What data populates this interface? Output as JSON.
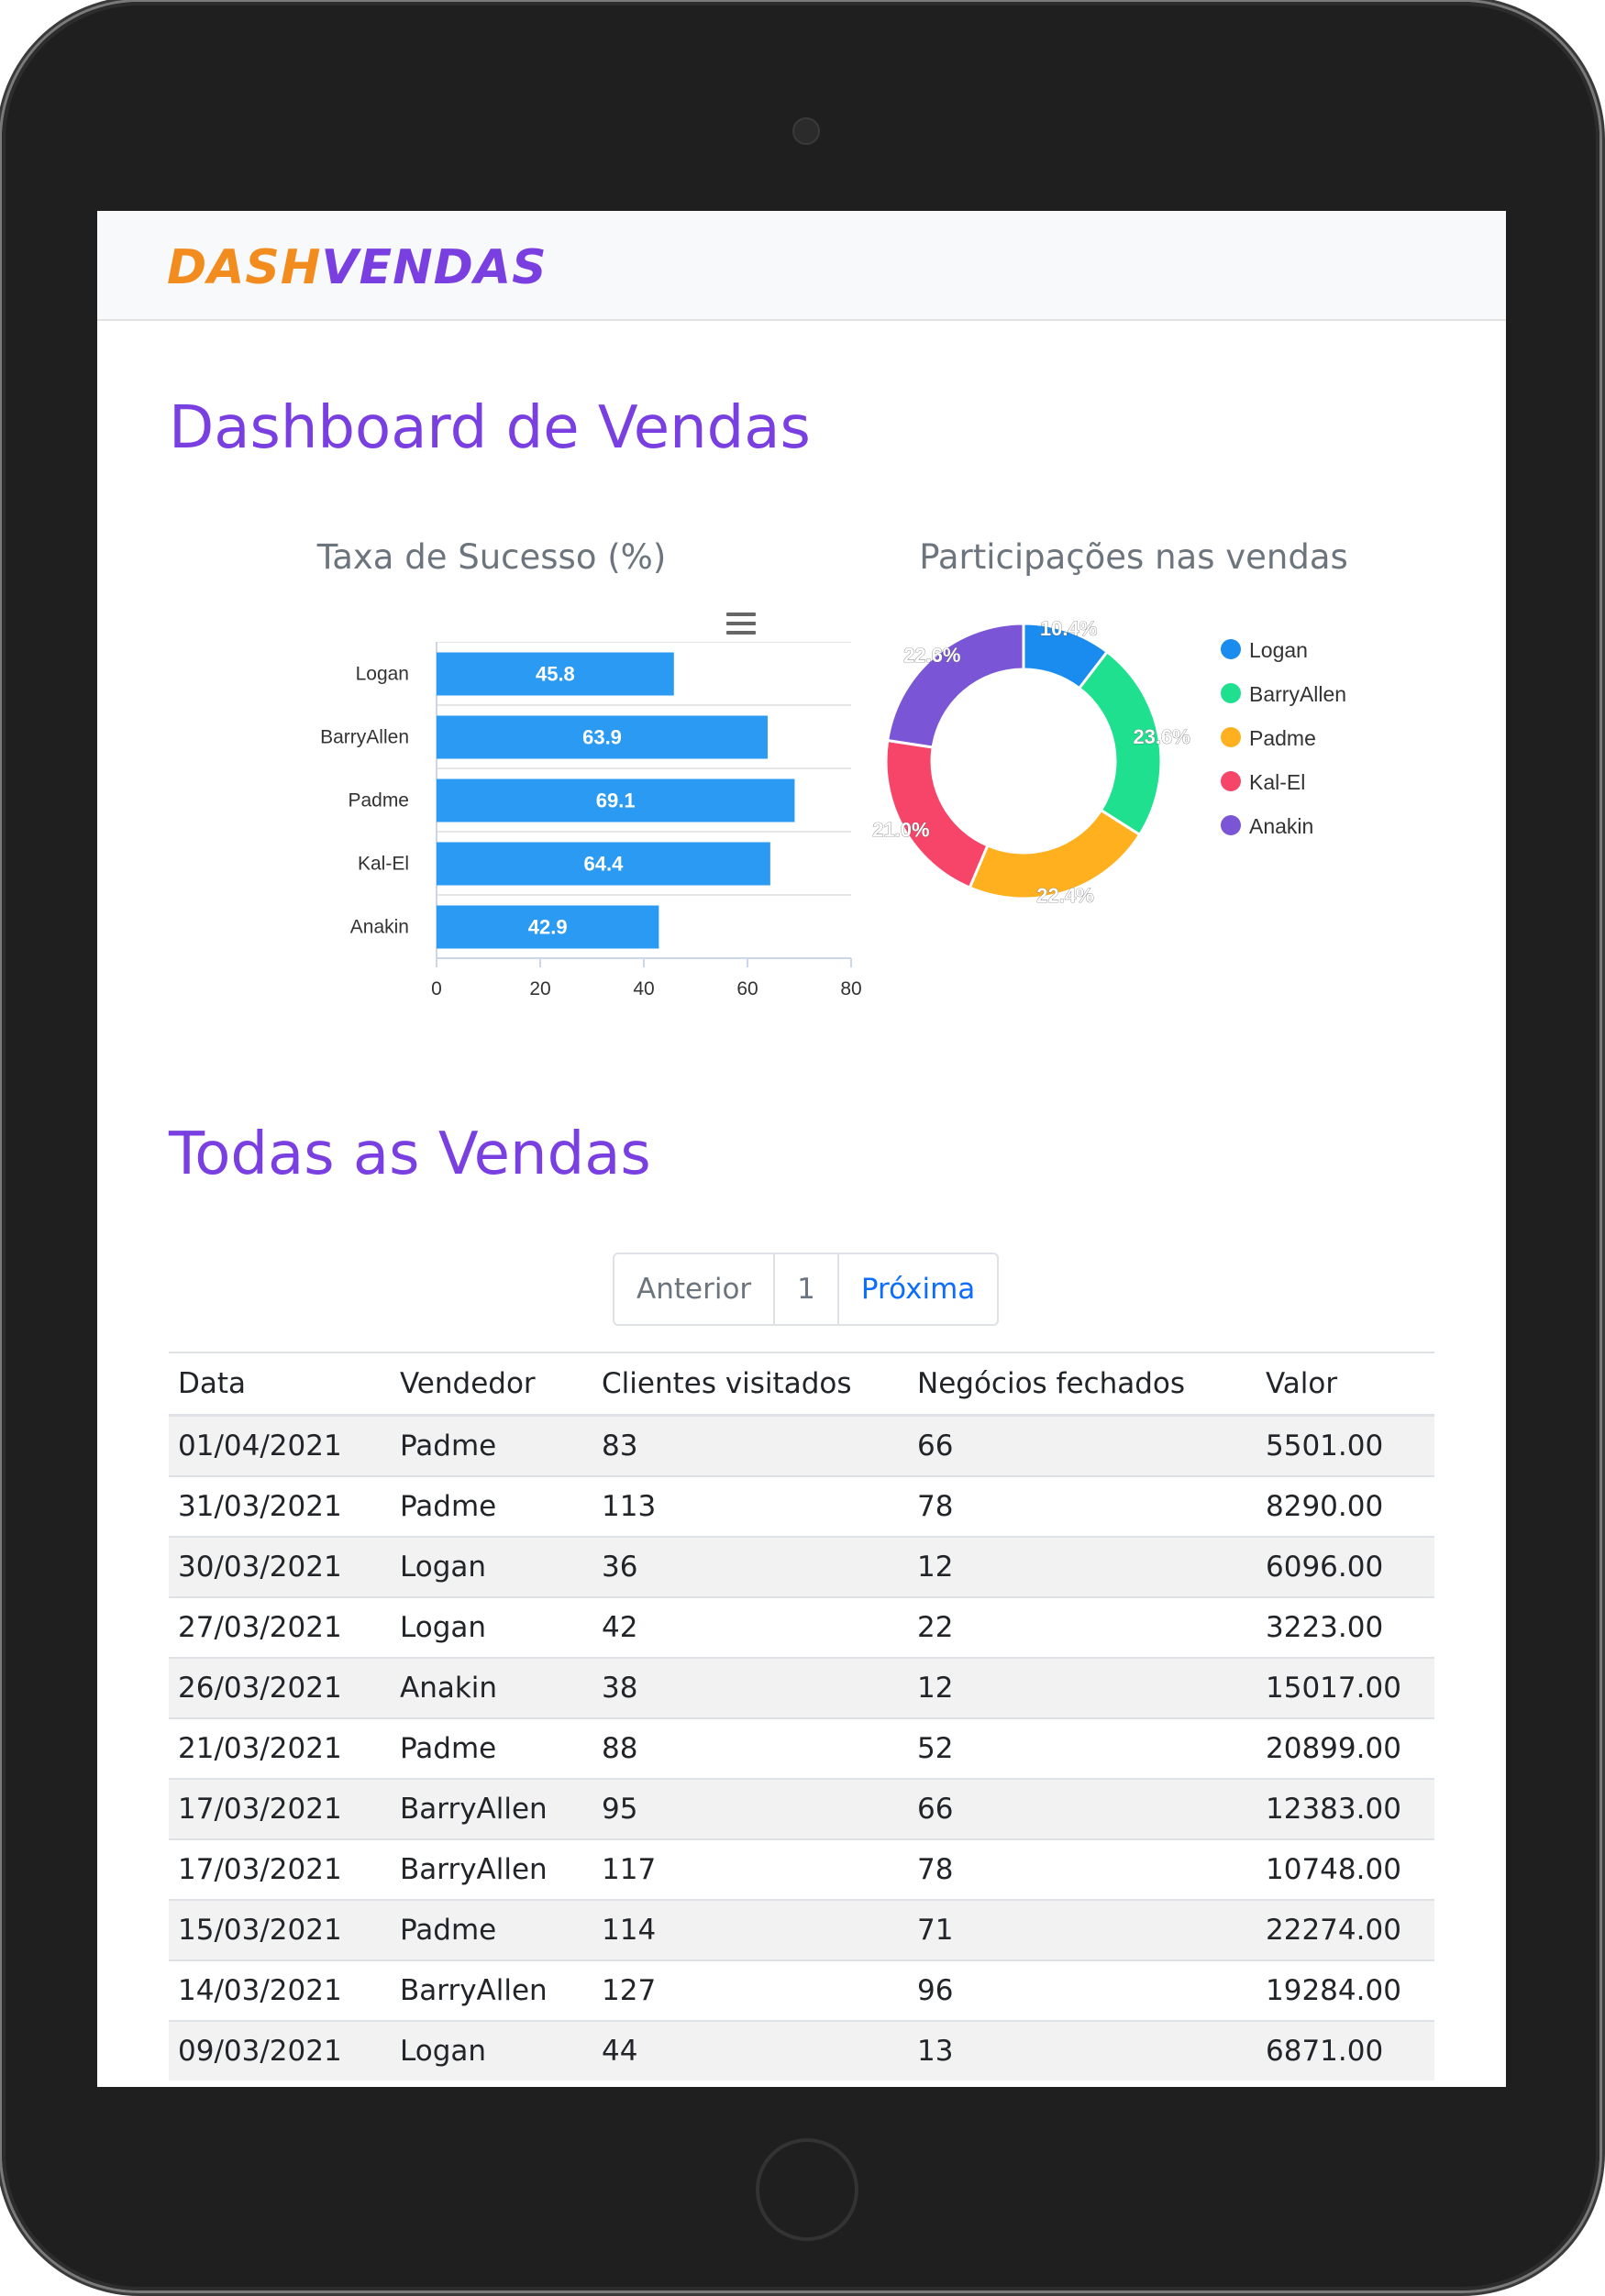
{
  "brand": {
    "part1": "DASH",
    "part2": "VENDAS"
  },
  "dashboard": {
    "title": "Dashboard de Vendas"
  },
  "bar_chart": {
    "title": "Taxa de Sucesso (%)",
    "menu_icon": "menu-icon"
  },
  "pie_chart": {
    "title": "Participações nas vendas"
  },
  "chart_data": [
    {
      "type": "bar",
      "orientation": "horizontal",
      "title": "Taxa de Sucesso (%)",
      "categories": [
        "Logan",
        "BarryAllen",
        "Padme",
        "Kal-El",
        "Anakin"
      ],
      "values": [
        45.8,
        63.9,
        69.1,
        64.4,
        42.9
      ],
      "data_labels": [
        "45.8",
        "63.9",
        "69.1",
        "64.4",
        "42.9"
      ],
      "xlim": [
        0,
        80
      ],
      "x_ticks": [
        "0",
        "20",
        "40",
        "60",
        "80"
      ],
      "color": "#2b9af3",
      "grid": true
    },
    {
      "type": "pie",
      "style": "donut",
      "title": "Participações nas vendas",
      "labels": [
        "Logan",
        "BarryAllen",
        "Padme",
        "Kal-El",
        "Anakin"
      ],
      "values": [
        10.4,
        23.6,
        22.4,
        21.0,
        22.6
      ],
      "data_labels": [
        "10.4%",
        "23.6%",
        "22.4%",
        "21.0%",
        "22.6%"
      ],
      "colors": [
        "#1a8cf0",
        "#1ee08f",
        "#ffb01f",
        "#f7456a",
        "#7a55d6"
      ],
      "legend": "right"
    }
  ],
  "sales": {
    "title": "Todas as Vendas",
    "pagination": {
      "prev": "Anterior",
      "page": "1",
      "next": "Próxima"
    },
    "columns": [
      "Data",
      "Vendedor",
      "Clientes visitados",
      "Negócios fechados",
      "Valor"
    ],
    "rows": [
      [
        "01/04/2021",
        "Padme",
        "83",
        "66",
        "5501.00"
      ],
      [
        "31/03/2021",
        "Padme",
        "113",
        "78",
        "8290.00"
      ],
      [
        "30/03/2021",
        "Logan",
        "36",
        "12",
        "6096.00"
      ],
      [
        "27/03/2021",
        "Logan",
        "42",
        "22",
        "3223.00"
      ],
      [
        "26/03/2021",
        "Anakin",
        "38",
        "12",
        "15017.00"
      ],
      [
        "21/03/2021",
        "Padme",
        "88",
        "52",
        "20899.00"
      ],
      [
        "17/03/2021",
        "BarryAllen",
        "95",
        "66",
        "12383.00"
      ],
      [
        "17/03/2021",
        "BarryAllen",
        "117",
        "78",
        "10748.00"
      ],
      [
        "15/03/2021",
        "Padme",
        "114",
        "71",
        "22274.00"
      ],
      [
        "14/03/2021",
        "BarryAllen",
        "127",
        "96",
        "19284.00"
      ],
      [
        "09/03/2021",
        "Logan",
        "44",
        "13",
        "6871.00"
      ]
    ]
  }
}
